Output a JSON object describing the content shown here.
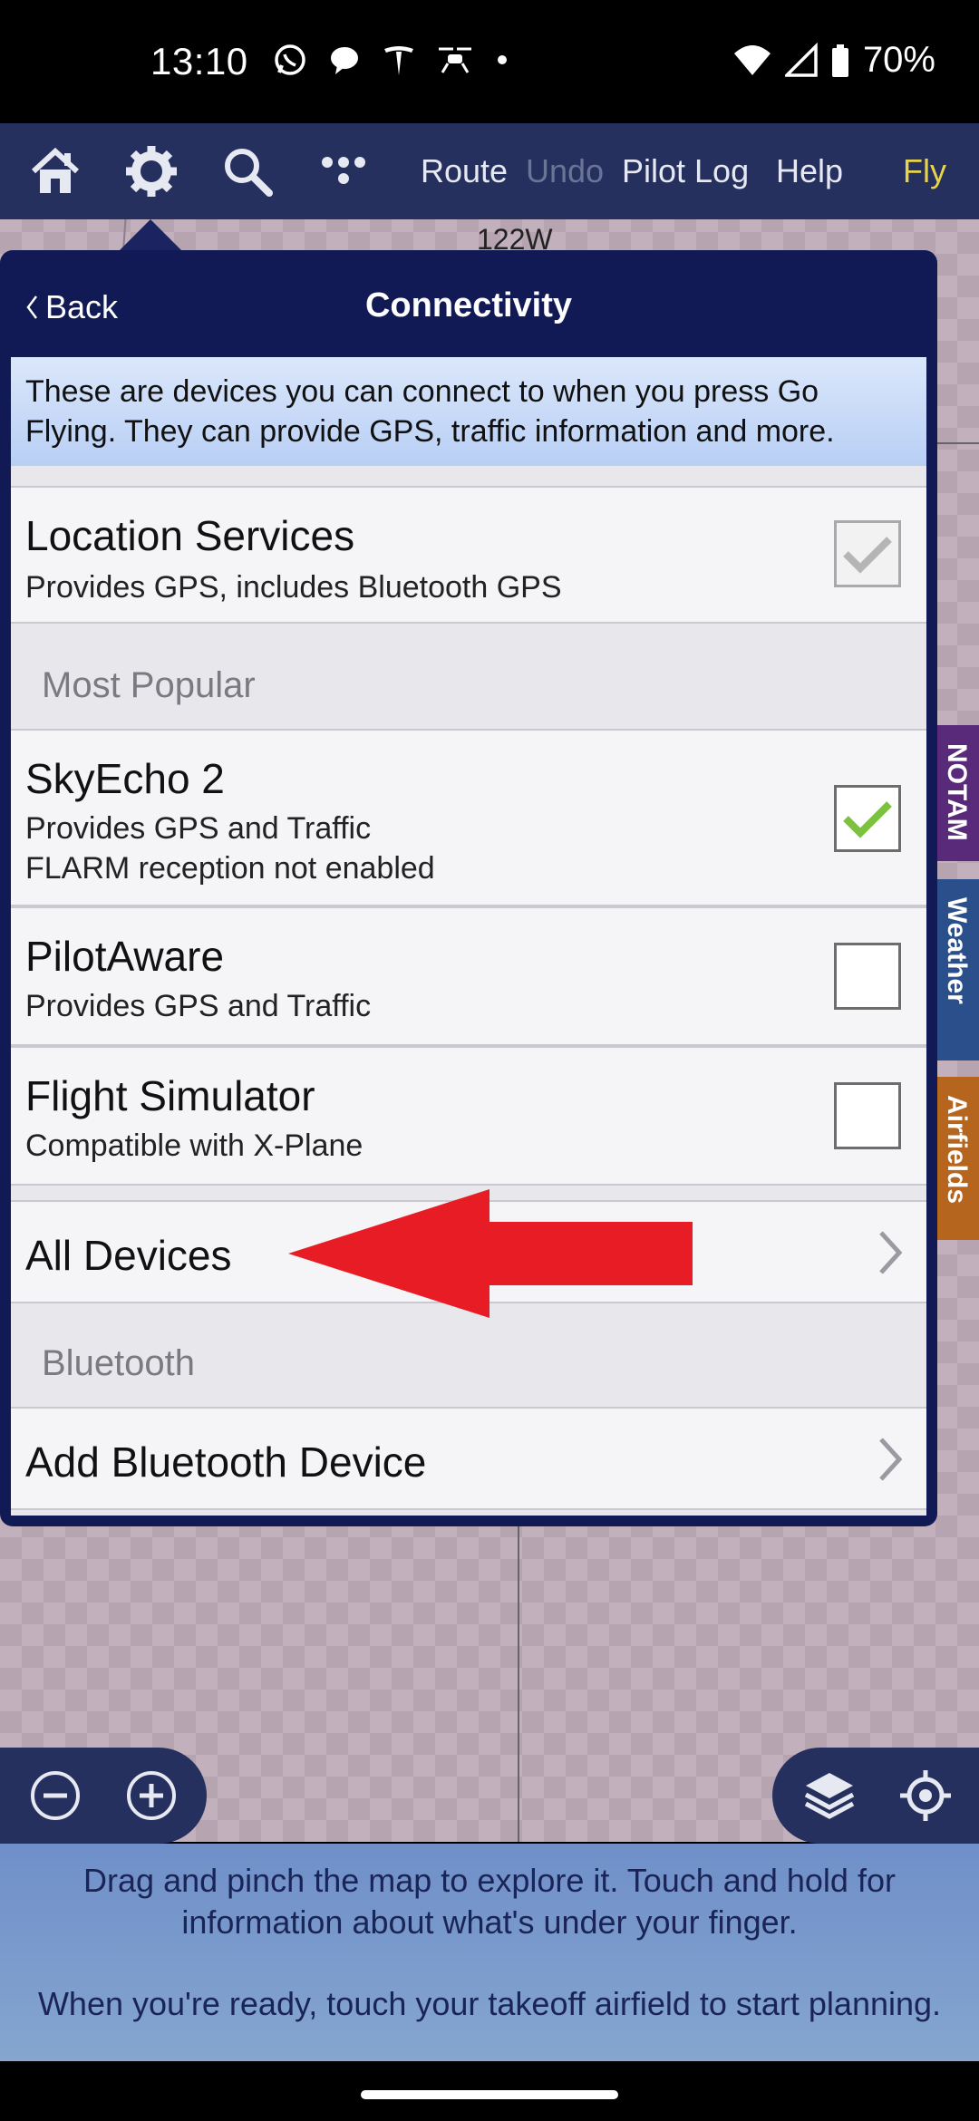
{
  "status_bar": {
    "time": "13:10",
    "battery": "70%",
    "left_icons": [
      "whatsapp-icon",
      "chat-bubble-icon",
      "tesla-icon",
      "drone-icon",
      "dot-icon"
    ],
    "right_icons": [
      "wifi-icon",
      "signal-icon",
      "battery-icon"
    ]
  },
  "map": {
    "label": "122W"
  },
  "toolbar": {
    "icons": [
      "home-icon",
      "gear-icon",
      "search-icon",
      "more-icon"
    ],
    "route": "Route",
    "undo": "Undo",
    "pilot_log": "Pilot Log",
    "help": "Help",
    "fly": "Fly",
    "fly_color": "#e8d44a"
  },
  "panel": {
    "back": "Back",
    "title": "Connectivity",
    "info": "These are devices you can connect to when you press Go Flying. They can provide GPS, traffic information and more.",
    "location": {
      "title": "Location Services",
      "subtitle": "Provides GPS, includes Bluetooth GPS",
      "checked": true,
      "disabled": true
    },
    "section_popular": "Most Popular",
    "devices": [
      {
        "title": "SkyEcho 2",
        "subtitle": "Provides GPS and Traffic",
        "subtitle2": "FLARM reception not enabled",
        "checked": true
      },
      {
        "title": "PilotAware",
        "subtitle": "Provides GPS and Traffic",
        "checked": false
      },
      {
        "title": "Flight Simulator",
        "subtitle": "Compatible with X-Plane",
        "checked": false
      }
    ],
    "all_devices": "All Devices",
    "section_bluetooth": "Bluetooth",
    "add_bluetooth": "Add Bluetooth Device"
  },
  "side_tabs": [
    {
      "label": "NOTAM",
      "color": "#5a2a7a"
    },
    {
      "label": "Weather",
      "color": "#2a4f8a"
    },
    {
      "label": "Airfields",
      "color": "#b5651d"
    }
  ],
  "annotation_arrow_color": "#e81c24",
  "help": {
    "line1": "Drag and pinch the map to explore it. Touch and hold for information about what's under your finger.",
    "line2": "When you're ready, touch your takeoff airfield to start planning."
  }
}
